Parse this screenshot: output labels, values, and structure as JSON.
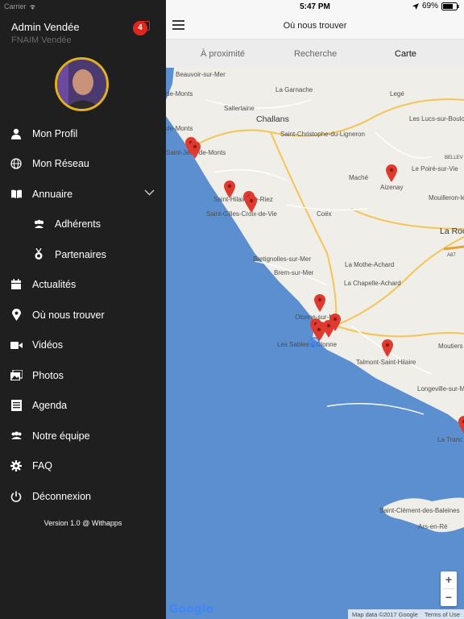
{
  "status_bar": {
    "carrier": "Carrier",
    "time": "5:47 PM",
    "battery": "69%"
  },
  "sidebar": {
    "user_name": "Admin Vendée",
    "user_org": "FNAIM Vendée",
    "notification_count": "4",
    "menu": [
      {
        "label": "Mon Profil",
        "icon": "user-icon"
      },
      {
        "label": "Mon Réseau",
        "icon": "globe-icon"
      },
      {
        "label": "Annuaire",
        "icon": "book-icon"
      },
      {
        "label": "Adhérents",
        "icon": "group-icon"
      },
      {
        "label": "Partenaires",
        "icon": "medal-icon"
      },
      {
        "label": "Actualités",
        "icon": "calendar-icon"
      },
      {
        "label": "Où nous trouver",
        "icon": "location-pin-icon"
      },
      {
        "label": "Vidéos",
        "icon": "video-camera-icon"
      },
      {
        "label": "Photos",
        "icon": "photos-icon"
      },
      {
        "label": "Agenda",
        "icon": "list-icon"
      },
      {
        "label": "Notre équipe",
        "icon": "team-icon"
      },
      {
        "label": "FAQ",
        "icon": "gear-icon"
      },
      {
        "label": "Déconnexion",
        "icon": "power-icon"
      }
    ],
    "version": "Version 1.0 @ Withapps"
  },
  "header": {
    "title": "Où nous trouver"
  },
  "tabs": [
    {
      "label": "À proximité"
    },
    {
      "label": "Recherche"
    },
    {
      "label": "Carte"
    }
  ],
  "map": {
    "places": [
      "Beauvoir-sur-Mer",
      "La Garnache",
      "Legé",
      "Les Lucs-sur-Boulogne",
      "de-Monts",
      "Sallertaine",
      "Challans",
      "Saint-Christophe-du-Ligneron",
      "BELLEV",
      "de-Monts",
      "Saint-Jean-de-Monts",
      "Le Poiré-sur-Vie",
      "Maché",
      "Aizenay",
      "Mouilleron-le",
      "Saint-Hilaire-de-Riez",
      "Saint-Gilles-Croix-de-Vie",
      "Coëx",
      "La Roc",
      "A87",
      "Bretignolles-sur-Mer",
      "La Mothe-Achard",
      "Brem-sur-Mer",
      "La Chapelle-Achard",
      "Olonne-sur-Mer",
      "Les Sables-d'Olonne",
      "Moutiers",
      "Talmont-Saint-Hilaire",
      "Longeville-sur-M",
      "La Tranc",
      "Saint-Clément-des-Baleines",
      "Ars-en-Ré"
    ],
    "zoom_in": "+",
    "zoom_out": "−",
    "logo": "Google",
    "map_data": "Map data ©2017 Google",
    "terms": "Terms of Use"
  },
  "colors": {
    "sidebar_bg": "#1f1f1f",
    "badge_red": "#e0271f",
    "avatar_ring": "#e2b11c",
    "sea_blue": "#5b8fcf",
    "marker_red": "#e03a2f"
  }
}
